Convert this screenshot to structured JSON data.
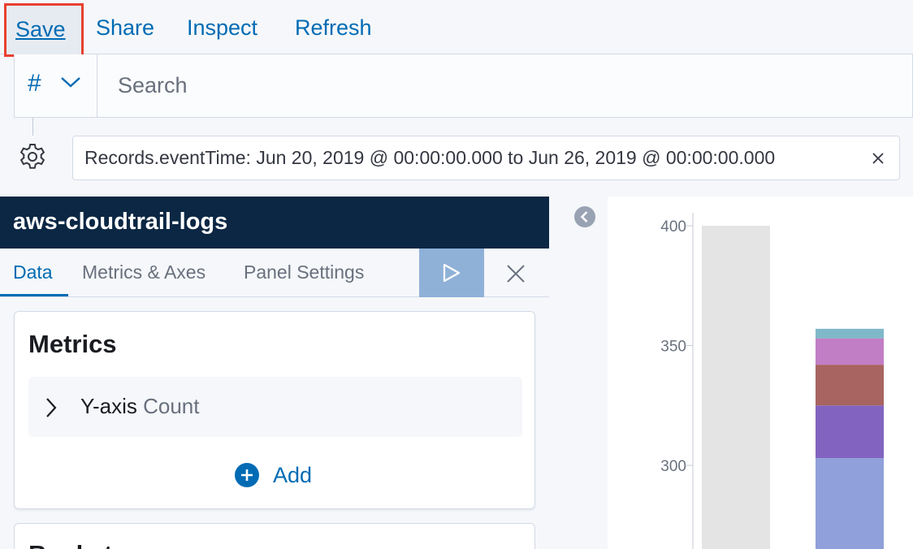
{
  "top_menu": {
    "items": [
      {
        "label": "Save"
      },
      {
        "label": "Share"
      },
      {
        "label": "Inspect"
      },
      {
        "label": "Refresh"
      }
    ]
  },
  "query_bar": {
    "language_symbol": "#",
    "search_placeholder": "Search"
  },
  "filter": {
    "label": "Records.eventTime: Jun 20, 2019 @ 00:00:00.000 to Jun 26, 2019 @ 00:00:00.000"
  },
  "editor": {
    "index_pattern": "aws-cloudtrail-logs",
    "tabs": [
      {
        "label": "Data",
        "active": true
      },
      {
        "label": "Metrics & Axes",
        "active": false
      },
      {
        "label": "Panel Settings",
        "active": false
      }
    ],
    "metrics": {
      "title": "Metrics",
      "aggregations": [
        {
          "axis": "Y-axis",
          "type": "Count"
        }
      ],
      "add_label": "Add"
    },
    "buckets": {
      "title": "Buckets"
    }
  },
  "colors": {
    "accent": "#006bb4",
    "header_bg": "#0b2744",
    "highlight_border": "#e8402e",
    "apply_button": "#8fb1d8"
  },
  "chart_data": {
    "type": "bar",
    "stacked": true,
    "y_ticks": [
      300,
      350,
      400
    ],
    "ylim": [
      265,
      420
    ],
    "bars": [
      {
        "segments": [
          {
            "value": 400,
            "color": "#e4e4e4"
          }
        ]
      },
      {
        "segments": [
          {
            "value": 303,
            "color": "#90a0da"
          },
          {
            "value": 22,
            "color": "#8264c0"
          },
          {
            "value": 17,
            "color": "#a86460"
          },
          {
            "value": 11,
            "color": "#c27ec5"
          },
          {
            "value": 4,
            "color": "#7fb9c9"
          }
        ]
      }
    ]
  }
}
